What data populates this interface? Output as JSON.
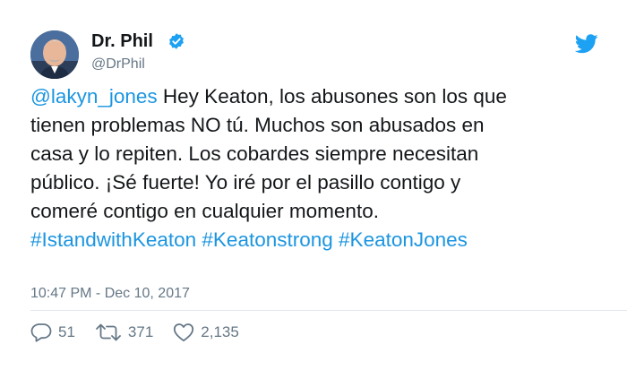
{
  "author": {
    "display_name": "Dr. Phil",
    "handle": "@DrPhil",
    "verified": true,
    "avatar_icon": "avatar-photo"
  },
  "tweet": {
    "mention": "@lakyn_jones",
    "lines": [
      " Hey Keaton, los abusones son los que",
      "tienen problemas NO tú. Muchos son abusados en",
      "casa y lo repiten. Los cobardes siempre necesitan",
      "público. ¡Sé fuerte! Yo iré por el pasillo contigo y",
      "comeré contigo en cualquier momento."
    ],
    "hashtags": [
      "#IstandwithKeaton",
      "#Keatonstrong",
      "#KeatonJones"
    ],
    "timestamp": "10:47 PM - Dec 10, 2017"
  },
  "actions": {
    "replies": "51",
    "retweets": "371",
    "likes": "2,135"
  },
  "colors": {
    "link": "#1b95e0",
    "muted": "#657786",
    "text": "#14171a",
    "divider": "#e1e8ed",
    "twitter_blue": "#1da1f2"
  },
  "icons": [
    "verified-badge-icon",
    "twitter-bird-icon",
    "reply-icon",
    "retweet-icon",
    "like-icon"
  ]
}
